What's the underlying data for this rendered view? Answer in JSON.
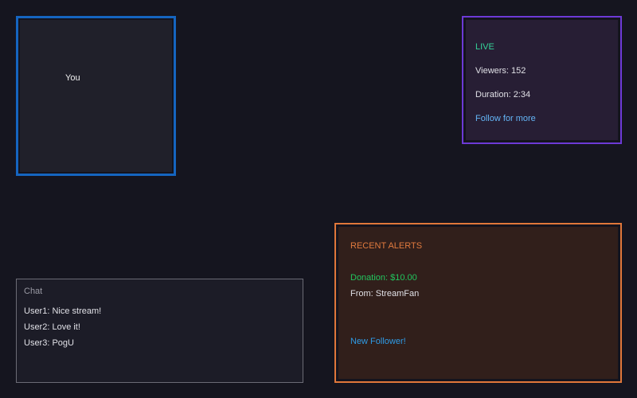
{
  "webcam": {
    "label": "You",
    "border_color": "#1565c0"
  },
  "stats": {
    "live_label": "LIVE",
    "viewers": "Viewers: 152",
    "duration": "Duration: 2:34",
    "follow_text": "Follow for more",
    "border_color": "#6d3ad6"
  },
  "alerts": {
    "title": "RECENT ALERTS",
    "donation": "Donation: $10.00",
    "from": "From: StreamFan",
    "new_follower": "New Follower!",
    "border_color": "#e0773a"
  },
  "chat": {
    "title": "Chat",
    "messages": [
      "User1: Nice stream!",
      "User2: Love it!",
      "User3: PogU"
    ]
  }
}
